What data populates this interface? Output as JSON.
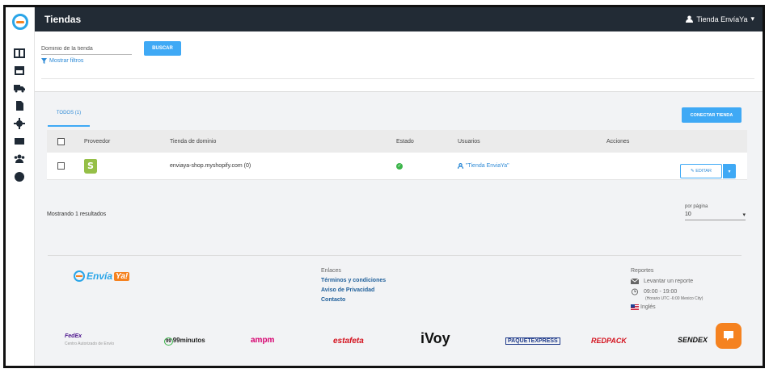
{
  "header": {
    "title": "Tiendas",
    "user": "Tienda EnvíaYa"
  },
  "search": {
    "placeholder": "Dominio de la tienda",
    "button": "BUSCAR",
    "filters": "Mostrar filtros"
  },
  "tabs": [
    {
      "label": "TODOS (1)"
    }
  ],
  "connect_button": "CONECTAR TIENDA",
  "table": {
    "headers": [
      "Proveedor",
      "Tienda de dominio",
      "Estado",
      "Usuarios",
      "Acciones"
    ],
    "rows": [
      {
        "domain": "enviaya-shop.myshopify.com (0)",
        "user": "\"Tienda EnviaYa\"",
        "edit": "EDITAR"
      }
    ]
  },
  "results": "Mostrando 1 resultados",
  "pagination": {
    "label": "por página",
    "value": "10"
  },
  "footer": {
    "brand_main": "Envía",
    "brand_accent": "Ya!",
    "links_title": "Enlaces",
    "links": [
      "Términos y condiciones",
      "Aviso de Privacidad",
      "Contacto"
    ],
    "reports_title": "Reportes",
    "report_link": "Levantar un reporte",
    "hours": "09:00 - 19:00",
    "timezone": "(Horario UTC -6:00 Mexico City)",
    "language": "Inglés"
  },
  "carriers": {
    "fedex": "FedEx",
    "fedex_sub": "Centro Autorizado de Envío",
    "c99": "99minutos",
    "ampm": "ampm",
    "estafeta": "estafeta",
    "ivoy": "iVoy",
    "paquetexpress": "PAQUETEXPRESS",
    "redpack": "REDPACK",
    "sendex": "SENDEX"
  }
}
